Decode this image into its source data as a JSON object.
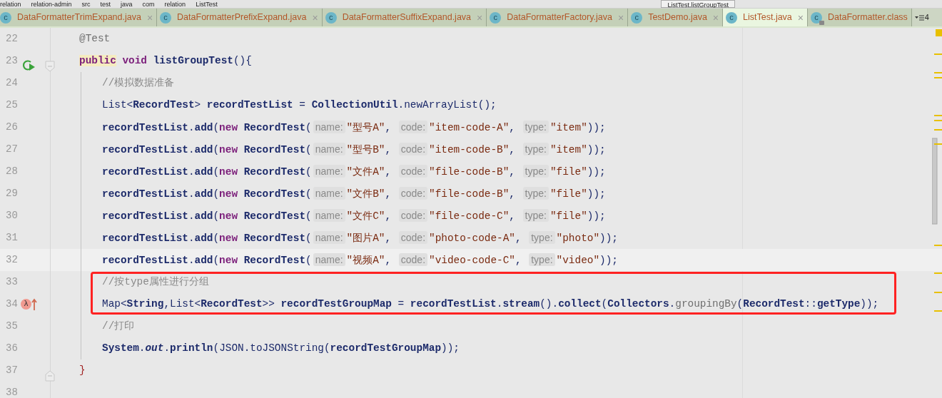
{
  "breadcrumbs": [
    "relation",
    "relation-admin",
    "src",
    "test",
    "java",
    "com",
    "relation",
    "ListTest"
  ],
  "run_config": "ListTest.listGroupTest",
  "tabs": [
    {
      "icon_letter": "c",
      "label": "DataFormatterTrimExpand.java",
      "close": "×",
      "selected": false,
      "locked": false
    },
    {
      "icon_letter": "c",
      "label": "DataFormatterPrefixExpand.java",
      "close": "×",
      "selected": false,
      "locked": false
    },
    {
      "icon_letter": "c",
      "label": "DataFormatterSuffixExpand.java",
      "close": "×",
      "selected": false,
      "locked": false
    },
    {
      "icon_letter": "c",
      "label": "DataFormatterFactory.java",
      "close": "×",
      "selected": false,
      "locked": false
    },
    {
      "icon_letter": "c",
      "label": "TestDemo.java",
      "close": "×",
      "selected": false,
      "locked": false
    },
    {
      "icon_letter": "c",
      "label": "ListTest.java",
      "close": "×",
      "selected": true,
      "locked": false
    },
    {
      "icon_letter": "c",
      "label": "DataFormatter.class",
      "selected": false,
      "locked": true
    }
  ],
  "tab_overflow": "4",
  "lines": [
    {
      "number": "22",
      "tokens": [
        {
          "kind": "annotation",
          "t": "@Test"
        }
      ]
    },
    {
      "number": "23",
      "gutter_icons": [
        {
          "kind": "run"
        },
        {
          "kind": "fold-start"
        }
      ],
      "tokens": [
        {
          "kind": "keyword-match",
          "t": "public"
        },
        {
          "kind": "keyword",
          "t": " void"
        },
        {
          "kind": "bold",
          "t": " listGroupTest"
        },
        {
          "kind": "plain",
          "t": "(){"
        }
      ],
      "children": [
        {
          "number": "24",
          "tokens": [
            {
              "kind": "comment",
              "t": "//模拟数据准备"
            }
          ]
        },
        {
          "number": "25",
          "tokens": [
            {
              "kind": "plain",
              "t": "List<"
            },
            {
              "kind": "bold",
              "t": "RecordTest"
            },
            {
              "kind": "plain",
              "t": "> "
            },
            {
              "kind": "bold",
              "t": "recordTestList"
            },
            {
              "kind": "plain",
              "t": " = "
            },
            {
              "kind": "bold",
              "t": "CollectionUtil"
            },
            {
              "kind": "plain",
              "t": "."
            },
            {
              "kind": "plain",
              "t": "newArrayList"
            },
            {
              "kind": "plain",
              "t": "();"
            }
          ]
        },
        {
          "number": "26",
          "tokens": [
            {
              "kind": "bold",
              "t": "recordTestList"
            },
            {
              "kind": "plain",
              "t": "."
            },
            {
              "kind": "bold",
              "t": "add"
            },
            {
              "kind": "plain",
              "t": "("
            },
            {
              "kind": "keyword",
              "t": "new"
            },
            {
              "kind": "bold",
              "t": " RecordTest"
            },
            {
              "kind": "plain",
              "t": "("
            },
            {
              "kind": "hint",
              "t": "name:"
            },
            {
              "kind": "string",
              "t": "\"型号A\""
            },
            {
              "kind": "plain",
              "t": ", "
            },
            {
              "kind": "hint",
              "t": "code:"
            },
            {
              "kind": "string",
              "t": "\"item-code-A\""
            },
            {
              "kind": "plain",
              "t": ", "
            },
            {
              "kind": "hint",
              "t": "type:"
            },
            {
              "kind": "string",
              "t": "\"item\""
            },
            {
              "kind": "plain",
              "t": "));"
            }
          ]
        },
        {
          "number": "27",
          "tokens": [
            {
              "kind": "bold",
              "t": "recordTestList"
            },
            {
              "kind": "plain",
              "t": "."
            },
            {
              "kind": "bold",
              "t": "add"
            },
            {
              "kind": "plain",
              "t": "("
            },
            {
              "kind": "keyword",
              "t": "new"
            },
            {
              "kind": "bold",
              "t": " RecordTest"
            },
            {
              "kind": "plain",
              "t": "("
            },
            {
              "kind": "hint",
              "t": "name:"
            },
            {
              "kind": "string",
              "t": "\"型号B\""
            },
            {
              "kind": "plain",
              "t": ", "
            },
            {
              "kind": "hint",
              "t": "code:"
            },
            {
              "kind": "string",
              "t": "\"item-code-B\""
            },
            {
              "kind": "plain",
              "t": ", "
            },
            {
              "kind": "hint",
              "t": "type:"
            },
            {
              "kind": "string",
              "t": "\"item\""
            },
            {
              "kind": "plain",
              "t": "));"
            }
          ]
        },
        {
          "number": "28",
          "tokens": [
            {
              "kind": "bold",
              "t": "recordTestList"
            },
            {
              "kind": "plain",
              "t": "."
            },
            {
              "kind": "bold",
              "t": "add"
            },
            {
              "kind": "plain",
              "t": "("
            },
            {
              "kind": "keyword",
              "t": "new"
            },
            {
              "kind": "bold",
              "t": " RecordTest"
            },
            {
              "kind": "plain",
              "t": "("
            },
            {
              "kind": "hint",
              "t": "name:"
            },
            {
              "kind": "string",
              "t": "\"文件A\""
            },
            {
              "kind": "plain",
              "t": ", "
            },
            {
              "kind": "hint",
              "t": "code:"
            },
            {
              "kind": "string",
              "t": "\"file-code-B\""
            },
            {
              "kind": "plain",
              "t": ", "
            },
            {
              "kind": "hint",
              "t": "type:"
            },
            {
              "kind": "string",
              "t": "\"file\""
            },
            {
              "kind": "plain",
              "t": "));"
            }
          ]
        },
        {
          "number": "29",
          "tokens": [
            {
              "kind": "bold",
              "t": "recordTestList"
            },
            {
              "kind": "plain",
              "t": "."
            },
            {
              "kind": "bold",
              "t": "add"
            },
            {
              "kind": "plain",
              "t": "("
            },
            {
              "kind": "keyword",
              "t": "new"
            },
            {
              "kind": "bold",
              "t": " RecordTest"
            },
            {
              "kind": "plain",
              "t": "("
            },
            {
              "kind": "hint",
              "t": "name:"
            },
            {
              "kind": "string",
              "t": "\"文件B\""
            },
            {
              "kind": "plain",
              "t": ", "
            },
            {
              "kind": "hint",
              "t": "code:"
            },
            {
              "kind": "string",
              "t": "\"file-code-B\""
            },
            {
              "kind": "plain",
              "t": ", "
            },
            {
              "kind": "hint",
              "t": "type:"
            },
            {
              "kind": "string",
              "t": "\"file\""
            },
            {
              "kind": "plain",
              "t": "));"
            }
          ]
        },
        {
          "number": "30",
          "tokens": [
            {
              "kind": "bold",
              "t": "recordTestList"
            },
            {
              "kind": "plain",
              "t": "."
            },
            {
              "kind": "bold",
              "t": "add"
            },
            {
              "kind": "plain",
              "t": "("
            },
            {
              "kind": "keyword",
              "t": "new"
            },
            {
              "kind": "bold",
              "t": " RecordTest"
            },
            {
              "kind": "plain",
              "t": "("
            },
            {
              "kind": "hint",
              "t": "name:"
            },
            {
              "kind": "string",
              "t": "\"文件C\""
            },
            {
              "kind": "plain",
              "t": ", "
            },
            {
              "kind": "hint",
              "t": "code:"
            },
            {
              "kind": "string",
              "t": "\"file-code-C\""
            },
            {
              "kind": "plain",
              "t": ", "
            },
            {
              "kind": "hint",
              "t": "type:"
            },
            {
              "kind": "string",
              "t": "\"file\""
            },
            {
              "kind": "plain",
              "t": "));"
            }
          ]
        },
        {
          "number": "31",
          "tokens": [
            {
              "kind": "bold",
              "t": "recordTestList"
            },
            {
              "kind": "plain",
              "t": "."
            },
            {
              "kind": "bold",
              "t": "add"
            },
            {
              "kind": "plain",
              "t": "("
            },
            {
              "kind": "keyword",
              "t": "new"
            },
            {
              "kind": "bold",
              "t": " RecordTest"
            },
            {
              "kind": "plain",
              "t": "("
            },
            {
              "kind": "hint",
              "t": "name:"
            },
            {
              "kind": "string",
              "t": "\"图片A\""
            },
            {
              "kind": "plain",
              "t": ", "
            },
            {
              "kind": "hint",
              "t": "code:"
            },
            {
              "kind": "string",
              "t": "\"photo-code-A\""
            },
            {
              "kind": "plain",
              "t": ", "
            },
            {
              "kind": "hint",
              "t": "type:"
            },
            {
              "kind": "string",
              "t": "\"photo\""
            },
            {
              "kind": "plain",
              "t": "));"
            }
          ]
        },
        {
          "number": "32",
          "current": true,
          "tokens": [
            {
              "kind": "bold",
              "t": "recordTestList"
            },
            {
              "kind": "plain",
              "t": "."
            },
            {
              "kind": "bold",
              "t": "add"
            },
            {
              "kind": "plain",
              "t": "("
            },
            {
              "kind": "keyword",
              "t": "new"
            },
            {
              "kind": "bold",
              "t": " RecordTest"
            },
            {
              "kind": "plain",
              "t": "("
            },
            {
              "kind": "hint",
              "t": "name:"
            },
            {
              "kind": "string",
              "t": "\"视频A\""
            },
            {
              "kind": "plain",
              "t": ", "
            },
            {
              "kind": "hint",
              "t": "code:"
            },
            {
              "kind": "string",
              "t": "\"video-code-C\""
            },
            {
              "kind": "plain",
              "t": ", "
            },
            {
              "kind": "hint",
              "t": "type:"
            },
            {
              "kind": "string",
              "t": "\"video\""
            },
            {
              "kind": "plain",
              "t": "));"
            }
          ]
        },
        {
          "number": "33",
          "boxed": true,
          "tokens": [
            {
              "kind": "comment",
              "t": "//按type属性进行分组"
            }
          ]
        },
        {
          "number": "34",
          "boxed": true,
          "gutter_icons": [
            {
              "kind": "lambda",
              "glyph": "λ"
            }
          ],
          "tokens": [
            {
              "kind": "plain",
              "t": "Map<"
            },
            {
              "kind": "bold",
              "t": "String"
            },
            {
              "kind": "plain",
              "t": ","
            },
            {
              "kind": "plain",
              "t": "List<"
            },
            {
              "kind": "bold",
              "t": "RecordTest"
            },
            {
              "kind": "plain",
              "t": ">> "
            },
            {
              "kind": "bold",
              "t": "recordTestGroupMap"
            },
            {
              "kind": "plain",
              "t": " = "
            },
            {
              "kind": "bold",
              "t": "recordTestList"
            },
            {
              "kind": "plain",
              "t": "."
            },
            {
              "kind": "bold",
              "t": "stream"
            },
            {
              "kind": "plain",
              "t": "()."
            },
            {
              "kind": "bold",
              "t": "collect"
            },
            {
              "kind": "plain",
              "t": "("
            },
            {
              "kind": "bold",
              "t": "Collectors"
            },
            {
              "kind": "plain",
              "t": "."
            },
            {
              "kind": "muted",
              "t": "groupingBy"
            },
            {
              "kind": "plain",
              "t": "("
            },
            {
              "kind": "bold",
              "t": "RecordTest"
            },
            {
              "kind": "plain",
              "t": "::"
            },
            {
              "kind": "bold",
              "t": "getType"
            },
            {
              "kind": "plain",
              "t": "));"
            }
          ]
        },
        {
          "number": "35",
          "tokens": [
            {
              "kind": "comment",
              "t": "//打印"
            }
          ]
        },
        {
          "number": "36",
          "tokens": [
            {
              "kind": "bold",
              "t": "System"
            },
            {
              "kind": "plain",
              "t": "."
            },
            {
              "kind": "static",
              "t": "out"
            },
            {
              "kind": "plain",
              "t": "."
            },
            {
              "kind": "bold",
              "t": "println"
            },
            {
              "kind": "plain",
              "t": "("
            },
            {
              "kind": "plain",
              "t": "JSON"
            },
            {
              "kind": "plain",
              "t": "."
            },
            {
              "kind": "plain",
              "t": "toJSONString"
            },
            {
              "kind": "plain",
              "t": "("
            },
            {
              "kind": "bold",
              "t": "recordTestGroupMap"
            },
            {
              "kind": "plain",
              "t": "));"
            }
          ]
        }
      ]
    },
    {
      "number": "37",
      "gutter_icons": [
        {
          "kind": "fold-end"
        }
      ],
      "tokens": [
        {
          "kind": "brace-match",
          "t": "}"
        }
      ]
    },
    {
      "number": "38"
    }
  ]
}
